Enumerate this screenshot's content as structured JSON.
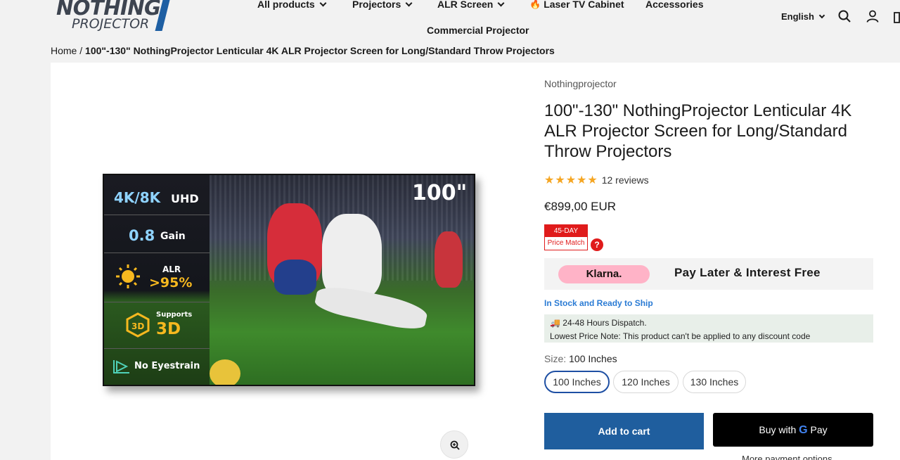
{
  "header": {
    "logo_line1": "NOTHING",
    "logo_line2": "PROJECTOR",
    "nav": [
      {
        "label": "All products"
      },
      {
        "label": "Projectors"
      },
      {
        "label": "ALR Screen"
      },
      {
        "label": "Laser TV Cabinet"
      },
      {
        "label": "Accessories"
      }
    ],
    "nav_row2": "Commercial Projector",
    "language": "English"
  },
  "breadcrumb": {
    "home": "Home",
    "separator": "/",
    "current": "100\"-130\" NothingProjector Lenticular 4K ALR Projector Screen for Long/Standard Throw Projectors"
  },
  "gallery": {
    "size_badge": "100\"",
    "features": {
      "res_big": "4K/8K",
      "res_small": "UHD",
      "gain_value": "0.8",
      "gain_label": "Gain",
      "alr_label": "ALR",
      "alr_value": ">95%",
      "supports_label": "Supports",
      "supports_value": "3D",
      "eyestrain": "No Eyestrain"
    }
  },
  "product": {
    "vendor": "Nothingprojector",
    "title": "100\"-130\" NothingProjector Lenticular 4K ALR Projector Screen for Long/Standard Throw Projectors",
    "rating": 5,
    "reviews": "12 reviews",
    "price": "€899,00 EUR",
    "badge_top": "45-DAY",
    "badge_bottom": "Price Match",
    "klarna_logo": "Klarna.",
    "klarna_text": "Pay Later & Interest Free",
    "stock": "In Stock and Ready to Ship",
    "dispatch": "24-48 Hours Dispatch.",
    "price_note": "Lowest Price Note: This product can't be applied to any discount code",
    "size_label": "Size:",
    "size_value": "100 Inches",
    "sizes": [
      "100 Inches",
      "120 Inches",
      "130 Inches"
    ],
    "add_to_cart": "Add to cart",
    "buy_with": "Buy with",
    "gpay_g": "G",
    "gpay_pay": "Pay",
    "more_options": "More payment options"
  },
  "colors": {
    "accent_blue": "#1f5e9e",
    "star": "#f5a623",
    "badge_red": "#e01b1b",
    "stock_blue": "#2a7bd4"
  }
}
